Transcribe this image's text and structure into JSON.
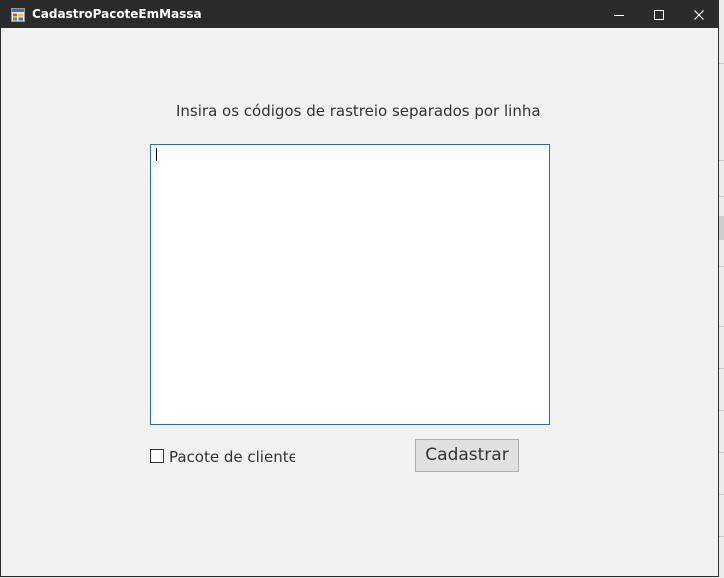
{
  "window": {
    "title": "CadastroPacoteEmMassa"
  },
  "form": {
    "instruction": "Insira os códigos de rastreio separados por linha",
    "codes_value": "",
    "checkbox_label": "Pacote de clientes",
    "checkbox_checked": false,
    "submit_label": "Cadastrar"
  },
  "colors": {
    "titlebar": "#2b2b2b",
    "window_background": "#f2f2f2",
    "textarea_border_focus": "#2a6ab0",
    "button_background": "#e1e1e1"
  }
}
